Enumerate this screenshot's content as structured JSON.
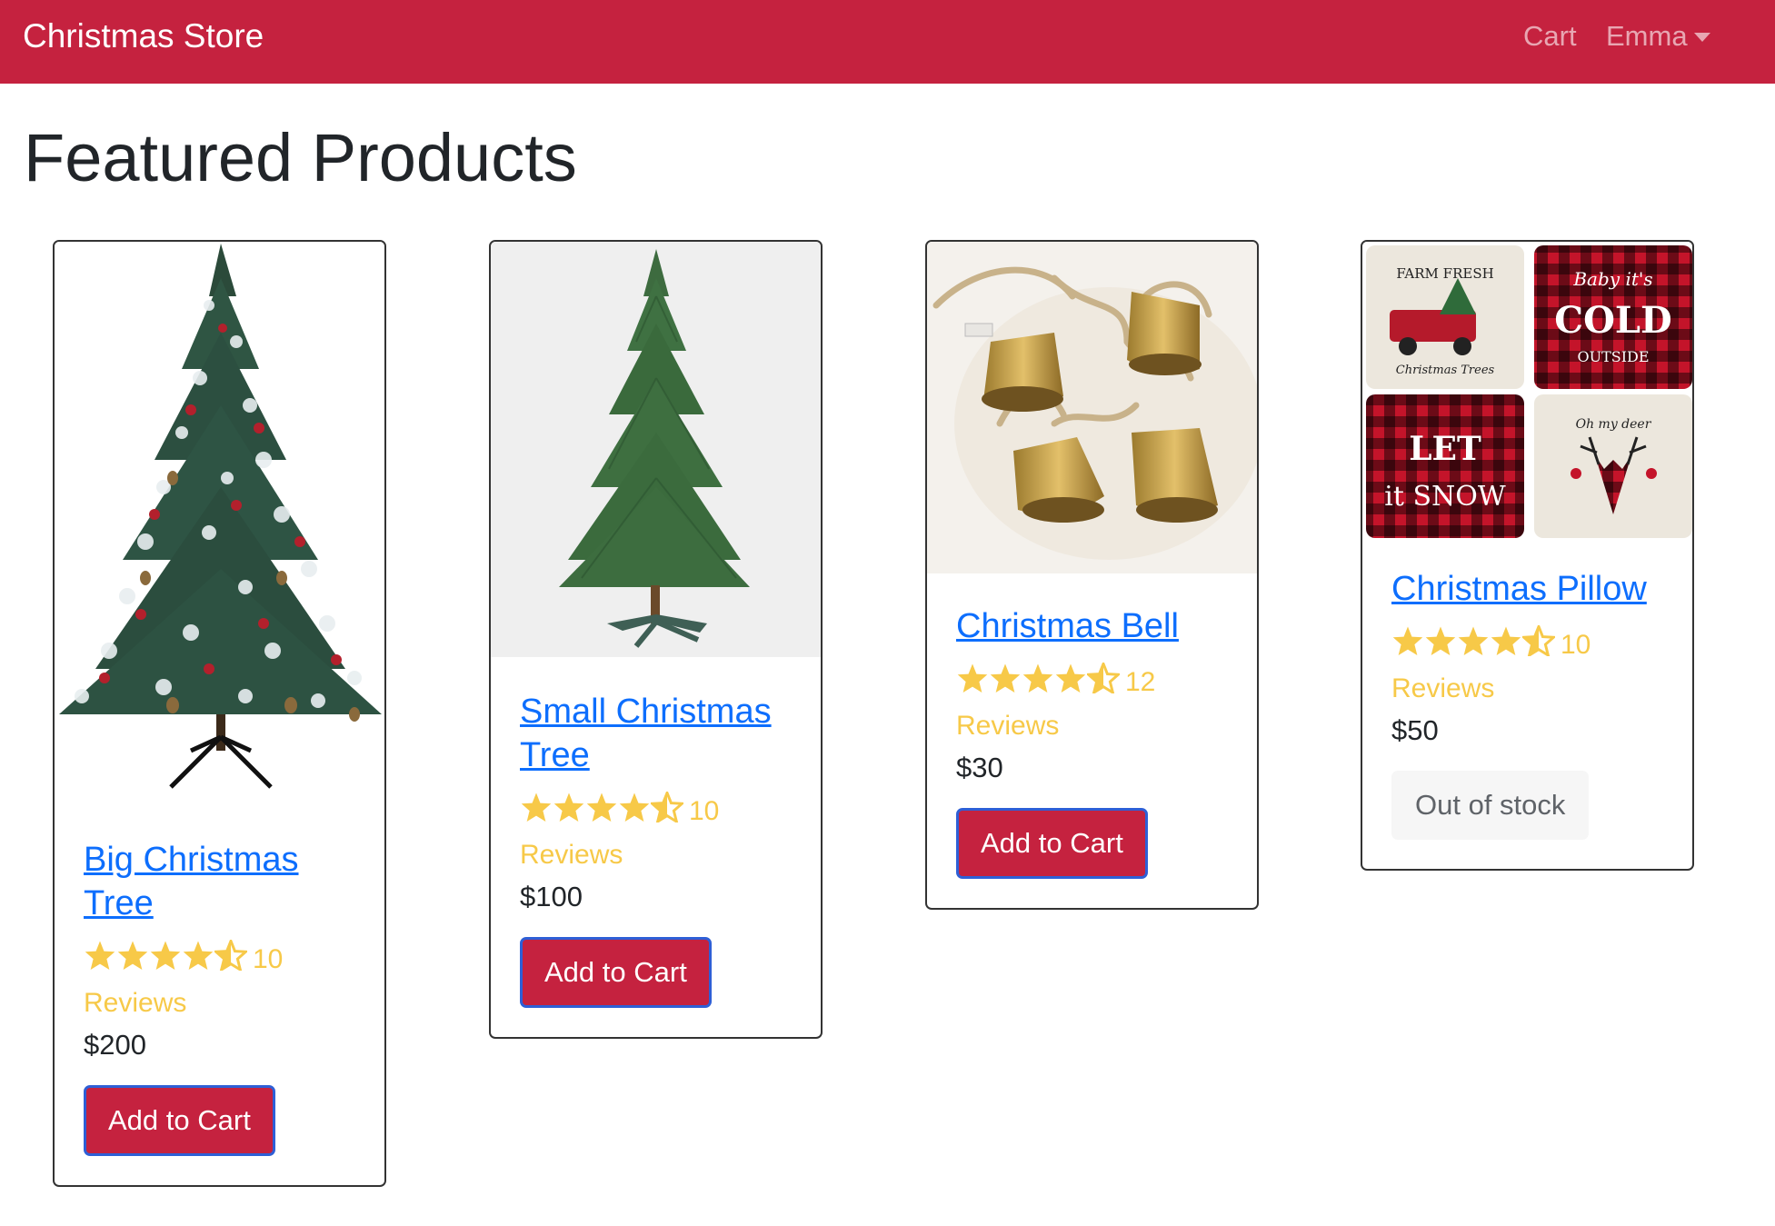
{
  "navbar": {
    "brand": "Christmas Store",
    "cart": "Cart",
    "user": "Emma"
  },
  "page": {
    "title": "Featured Products"
  },
  "colors": {
    "navbar": "#c5223f",
    "link": "#0d6efd",
    "star": "#f7c948",
    "button": "#c5223f",
    "button_border": "#2e5fd6"
  },
  "products": [
    {
      "name": "Big Christmas Tree",
      "rating": 4.5,
      "reviews": "10 Reviews",
      "price": "$200",
      "action": "Add to Cart",
      "image_icon": "frosted-christmas-tree-image"
    },
    {
      "name": "Small Christmas Tree",
      "rating": 4.5,
      "reviews": "10 Reviews",
      "price": "$100",
      "action": "Add to Cart",
      "image_icon": "green-christmas-tree-image"
    },
    {
      "name": "Christmas Bell",
      "rating": 4.5,
      "reviews": "12 Reviews",
      "price": "$30",
      "action": "Add to Cart",
      "image_icon": "brass-bells-image"
    },
    {
      "name": "Christmas Pillow",
      "rating": 4.5,
      "reviews": "10 Reviews",
      "price": "$50",
      "action": "Out of stock",
      "image_icon": "christmas-pillows-image"
    }
  ],
  "pillow_text": {
    "top_left": "FARM FRESH",
    "top_left_sub": "Christmas Trees",
    "top_right_1": "Baby it's",
    "top_right_2": "COLD",
    "top_right_3": "OUTSIDE",
    "bottom_left_1": "LET",
    "bottom_left_2": "it SNOW",
    "bottom_right": "Oh my deer"
  }
}
